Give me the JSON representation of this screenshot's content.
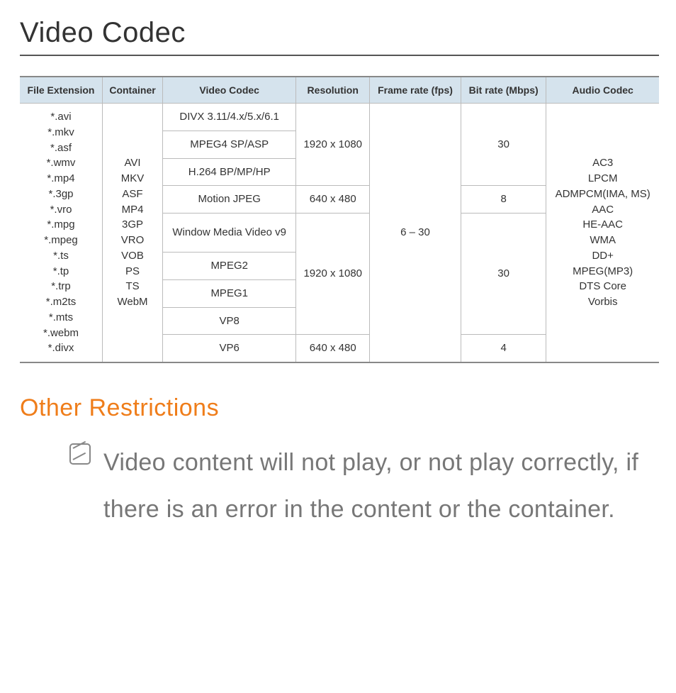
{
  "title": "Video Codec",
  "table": {
    "headers": {
      "ext": "File Extension",
      "container": "Container",
      "vcodec": "Video Codec",
      "res": "Resolution",
      "fps": "Frame rate (fps)",
      "bitrate": "Bit rate (Mbps)",
      "acodec": "Audio Codec"
    },
    "extensions": [
      "*.avi",
      "*.mkv",
      "*.asf",
      "*.wmv",
      "*.mp4",
      "*.3gp",
      "*.vro",
      "*.mpg",
      "*.mpeg",
      "*.ts",
      "*.tp",
      "*.trp",
      "*.m2ts",
      "*.mts",
      "*.webm",
      "*.divx"
    ],
    "containers": [
      "AVI",
      "MKV",
      "ASF",
      "MP4",
      "3GP",
      "VRO",
      "VOB",
      "PS",
      "TS",
      "WebM"
    ],
    "vcodecs": {
      "divx": "DIVX 3.11/4.x/5.x/6.1",
      "mpeg4": "MPEG4 SP/ASP",
      "h264": "H.264 BP/MP/HP",
      "mjpeg": "Motion JPEG",
      "wmv9": "Window Media Video v9",
      "mpeg2": "MPEG2",
      "mpeg1": "MPEG1",
      "vp8": "VP8",
      "vp6": "VP6"
    },
    "res_1080": "1920 x 1080",
    "res_480": "640 x 480",
    "fps_range": "6 – 30",
    "br_30": "30",
    "br_8": "8",
    "br_4": "4",
    "acodecs": [
      "AC3",
      "LPCM",
      "ADMPCM(IMA, MS)",
      "AAC",
      "HE-AAC",
      "WMA",
      "DD+",
      "MPEG(MP3)",
      "DTS Core",
      "Vorbis"
    ]
  },
  "section2_title": "Other Restrictions",
  "note1": "Video content will not play, or not play correctly, if there is an error in the content or the container."
}
